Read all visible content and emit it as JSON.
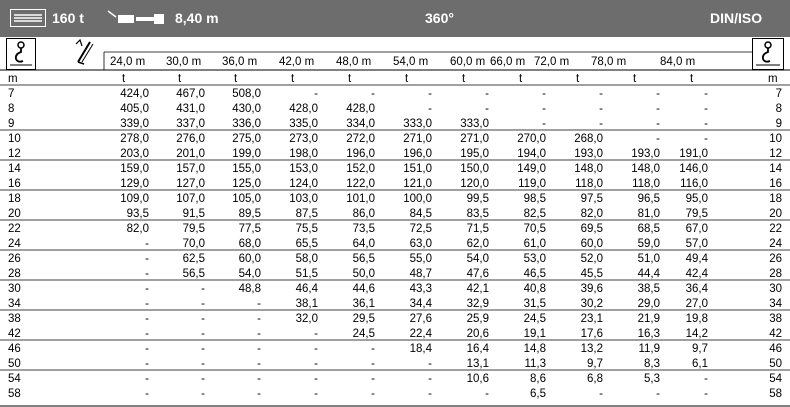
{
  "header": {
    "capacity": "160 t",
    "boom_length": "8,40  m",
    "slew_range": "360°",
    "standard": "DIN/ISO",
    "colors": {
      "bar": "#6d6d6d",
      "text": "#ffffff",
      "row_alt": "#ffffff",
      "grid": "#000000"
    },
    "icons": [
      "boom-length-icon",
      "counterweight-icon"
    ]
  },
  "table": {
    "column_headers": [
      "24,0 m",
      "30,0 m",
      "36,0 m",
      "42,0 m",
      "48,0 m",
      "54,0 m",
      "60,0 m",
      "66,0 m",
      "72,0 m",
      "78,0 m",
      "84,0 m"
    ],
    "left_icon": "hook-load-icon",
    "boom_icon": "luffing-jib-icon",
    "right_icon": "hook-load-icon",
    "unit_row": {
      "radius_unit": "m",
      "load_unit": "t"
    },
    "rows": [
      {
        "radius": "7",
        "values": [
          "424,0",
          "467,0",
          "508,0",
          "-",
          "-",
          "-",
          "-",
          "-",
          "-",
          "-",
          "-"
        ]
      },
      {
        "radius": "8",
        "values": [
          "405,0",
          "431,0",
          "430,0",
          "428,0",
          "428,0",
          "-",
          "-",
          "-",
          "-",
          "-",
          "-"
        ]
      },
      {
        "radius": "9",
        "values": [
          "339,0",
          "337,0",
          "336,0",
          "335,0",
          "334,0",
          "333,0",
          "333,0",
          "-",
          "-",
          "-",
          "-"
        ]
      },
      {
        "radius": "10",
        "values": [
          "278,0",
          "276,0",
          "275,0",
          "273,0",
          "272,0",
          "271,0",
          "271,0",
          "270,0",
          "268,0",
          "-",
          "-"
        ]
      },
      {
        "radius": "12",
        "values": [
          "203,0",
          "201,0",
          "199,0",
          "198,0",
          "196,0",
          "196,0",
          "195,0",
          "194,0",
          "193,0",
          "193,0",
          "191,0"
        ]
      },
      {
        "radius": "14",
        "values": [
          "159,0",
          "157,0",
          "155,0",
          "153,0",
          "152,0",
          "151,0",
          "150,0",
          "149,0",
          "148,0",
          "148,0",
          "146,0"
        ]
      },
      {
        "radius": "16",
        "values": [
          "129,0",
          "127,0",
          "125,0",
          "124,0",
          "122,0",
          "121,0",
          "120,0",
          "119,0",
          "118,0",
          "118,0",
          "116,0"
        ]
      },
      {
        "radius": "18",
        "values": [
          "109,0",
          "107,0",
          "105,0",
          "103,0",
          "101,0",
          "100,0",
          "99,5",
          "98,5",
          "97,5",
          "96,5",
          "95,0"
        ]
      },
      {
        "radius": "20",
        "values": [
          "93,5",
          "91,5",
          "89,5",
          "87,5",
          "86,0",
          "84,5",
          "83,5",
          "82,5",
          "82,0",
          "81,0",
          "79,5"
        ]
      },
      {
        "radius": "22",
        "values": [
          "82,0",
          "79,5",
          "77,5",
          "75,5",
          "73,5",
          "72,5",
          "71,5",
          "70,5",
          "69,5",
          "68,5",
          "67,0"
        ]
      },
      {
        "radius": "24",
        "values": [
          "-",
          "70,0",
          "68,0",
          "65,5",
          "64,0",
          "63,0",
          "62,0",
          "61,0",
          "60,0",
          "59,0",
          "57,0"
        ]
      },
      {
        "radius": "26",
        "values": [
          "-",
          "62,5",
          "60,0",
          "58,0",
          "56,5",
          "55,0",
          "54,0",
          "53,0",
          "52,0",
          "51,0",
          "49,4"
        ]
      },
      {
        "radius": "28",
        "values": [
          "-",
          "56,5",
          "54,0",
          "51,5",
          "50,0",
          "48,7",
          "47,6",
          "46,5",
          "45,5",
          "44,4",
          "42,4"
        ]
      },
      {
        "radius": "30",
        "values": [
          "-",
          "-",
          "48,8",
          "46,4",
          "44,6",
          "43,3",
          "42,1",
          "40,8",
          "39,6",
          "38,5",
          "36,4"
        ]
      },
      {
        "radius": "34",
        "values": [
          "-",
          "-",
          "-",
          "38,1",
          "36,1",
          "34,4",
          "32,9",
          "31,5",
          "30,2",
          "29,0",
          "27,0"
        ]
      },
      {
        "radius": "38",
        "values": [
          "-",
          "-",
          "-",
          "32,0",
          "29,5",
          "27,6",
          "25,9",
          "24,5",
          "23,1",
          "21,9",
          "19,8"
        ]
      },
      {
        "radius": "42",
        "values": [
          "-",
          "-",
          "-",
          "-",
          "24,5",
          "22,4",
          "20,6",
          "19,1",
          "17,6",
          "16,3",
          "14,2"
        ]
      },
      {
        "radius": "46",
        "values": [
          "-",
          "-",
          "-",
          "-",
          "-",
          "18,4",
          "16,4",
          "14,8",
          "13,2",
          "11,9",
          "9,7"
        ]
      },
      {
        "radius": "50",
        "values": [
          "-",
          "-",
          "-",
          "-",
          "-",
          "-",
          "13,1",
          "11,3",
          "9,7",
          "8,3",
          "6,1"
        ]
      },
      {
        "radius": "54",
        "values": [
          "-",
          "-",
          "-",
          "-",
          "-",
          "-",
          "10,6",
          "8,6",
          "6,8",
          "5,3",
          "-"
        ]
      },
      {
        "radius": "58",
        "values": [
          "-",
          "-",
          "-",
          "-",
          "-",
          "-",
          "-",
          "6,5",
          "-",
          "-",
          "-"
        ]
      }
    ]
  }
}
